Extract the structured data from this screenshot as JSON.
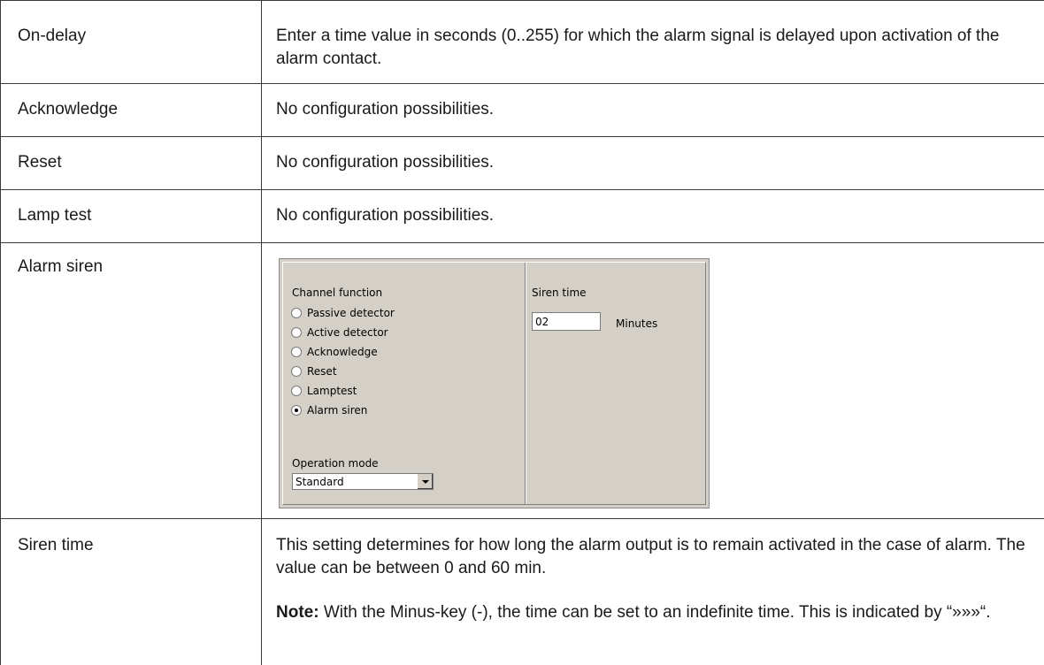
{
  "rows": [
    {
      "label": "On-delay",
      "text": "Enter a time value in seconds (0..255) for which the alarm signal is delayed upon activation of the alarm contact."
    },
    {
      "label": "Acknowledge",
      "text": "No configuration possibilities."
    },
    {
      "label": "Reset",
      "text": "No configuration possibilities."
    },
    {
      "label": "Lamp test",
      "text": "No configuration possibilities."
    },
    {
      "label": "Alarm siren"
    },
    {
      "label": "Siren time",
      "text": "This setting determines for how long the alarm output is to remain activated in the case of alarm. The value can be between 0 and 60 min.",
      "note_label": "Note:",
      "note_text": "With the Minus-key (-), the time can be set to an indefinite time. This is indicated by “»»»“."
    }
  ],
  "dialog": {
    "channel_function_label": "Channel function",
    "options": [
      {
        "label": "Passive detector",
        "checked": false
      },
      {
        "label": "Active detector",
        "checked": false
      },
      {
        "label": "Acknowledge",
        "checked": false
      },
      {
        "label": "Reset",
        "checked": false
      },
      {
        "label": "Lamptest",
        "checked": false
      },
      {
        "label": "Alarm siren",
        "checked": true
      }
    ],
    "operation_mode_label": "Operation mode",
    "operation_mode_value": "Standard",
    "siren_time_label": "Siren time",
    "siren_time_value": "02",
    "siren_time_unit": "Minutes"
  }
}
